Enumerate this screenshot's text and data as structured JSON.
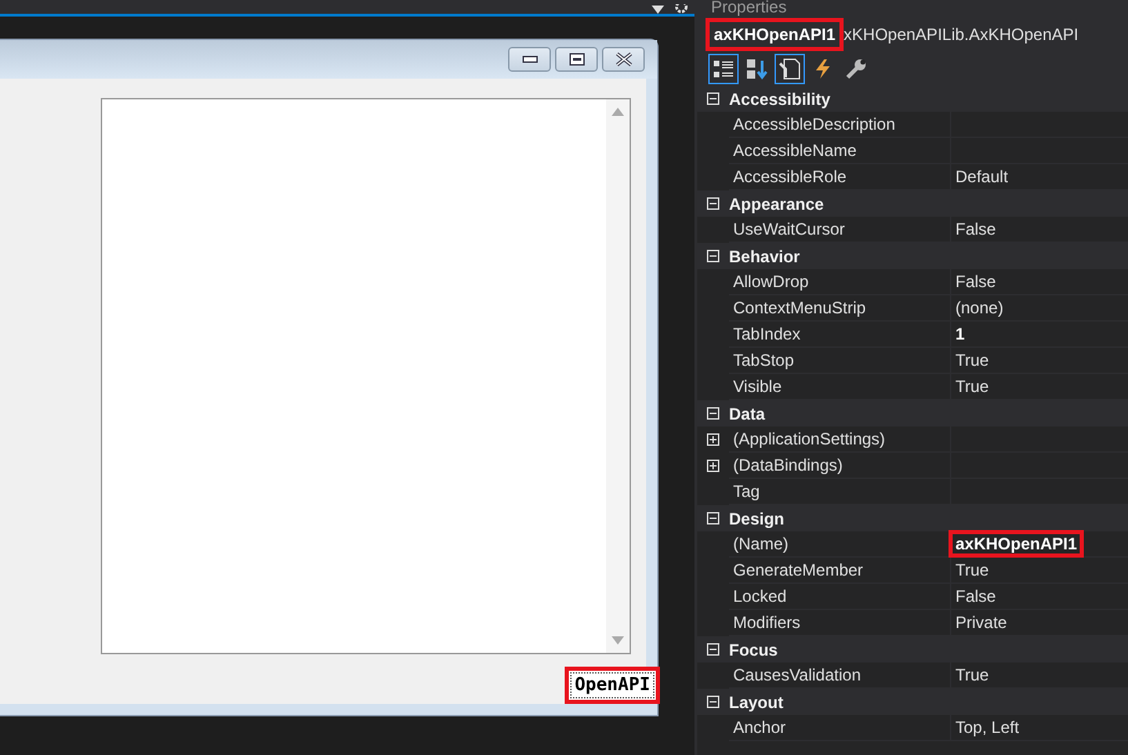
{
  "panel_title": "Properties",
  "object_selector": {
    "name": "axKHOpenAPI1",
    "type": "xKHOpenAPILib.AxKHOpenAPI",
    "highlighted": true
  },
  "toolbar": [
    {
      "kind": "categorized",
      "selected": true
    },
    {
      "kind": "alphabetical",
      "selected": false
    },
    {
      "kind": "properties",
      "selected": true
    },
    {
      "kind": "events",
      "selected": false
    },
    {
      "kind": "pages",
      "selected": false
    }
  ],
  "categories": [
    {
      "name": "Accessibility",
      "expanded": true,
      "properties": [
        {
          "name": "AccessibleDescription"
        },
        {
          "name": "AccessibleName"
        },
        {
          "name": "AccessibleRole",
          "value": "Default"
        }
      ]
    },
    {
      "name": "Appearance",
      "expanded": true,
      "properties": [
        {
          "name": "UseWaitCursor",
          "value": "False"
        }
      ]
    },
    {
      "name": "Behavior",
      "expanded": true,
      "properties": [
        {
          "name": "AllowDrop",
          "value": "False"
        },
        {
          "name": "ContextMenuStrip",
          "value": "(none)"
        },
        {
          "name": "TabIndex",
          "value": "1",
          "bold": true
        },
        {
          "name": "TabStop",
          "value": "True"
        },
        {
          "name": "Visible",
          "value": "True"
        }
      ]
    },
    {
      "name": "Data",
      "expanded": true,
      "properties": [
        {
          "name": "(ApplicationSettings)",
          "expandable": true
        },
        {
          "name": "(DataBindings)",
          "expandable": true
        },
        {
          "name": "Tag"
        }
      ]
    },
    {
      "name": "Design",
      "expanded": true,
      "properties": [
        {
          "name": "(Name)",
          "value": "axKHOpenAPI1",
          "bold": true,
          "highlighted": true
        },
        {
          "name": "GenerateMember",
          "value": "True"
        },
        {
          "name": "Locked",
          "value": "False"
        },
        {
          "name": "Modifiers",
          "value": "Private"
        }
      ]
    },
    {
      "name": "Focus",
      "expanded": true,
      "properties": [
        {
          "name": "CausesValidation",
          "value": "True"
        }
      ]
    },
    {
      "name": "Layout",
      "expanded": true,
      "properties": [
        {
          "name": "Anchor",
          "value": "Top, Left"
        }
      ]
    }
  ],
  "designer": {
    "control": {
      "label": "OpenAPI",
      "highlighted": true
    }
  }
}
